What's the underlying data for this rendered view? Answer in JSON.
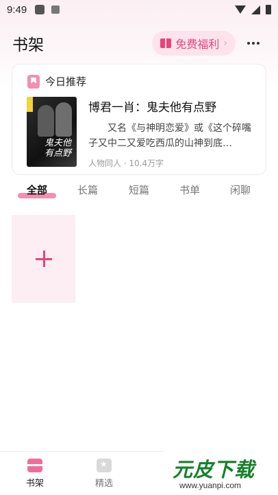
{
  "status_bar": {
    "time": "9:49"
  },
  "header": {
    "title": "书架",
    "welfare_label": "免费福利",
    "welfare_arrow": "›"
  },
  "recommendation": {
    "label": "今日推荐",
    "cover_text": "鬼夫他有点野",
    "book_title": "博君一肖：鬼夫他有点野",
    "description": "又名《与神明恋爱》或《这个碎嘴子又中二又爱吃西瓜的山神到底…",
    "meta": "人物同人 · 10.4万字"
  },
  "tabs": [
    {
      "label": "全部",
      "active": true
    },
    {
      "label": "长篇",
      "active": false
    },
    {
      "label": "短篇",
      "active": false
    },
    {
      "label": "书单",
      "active": false
    },
    {
      "label": "闲聊",
      "active": false
    }
  ],
  "bottom_nav": [
    {
      "label": "书架",
      "icon": "shelf-icon",
      "active": true
    },
    {
      "label": "精选",
      "icon": "featured-icon",
      "active": false
    }
  ],
  "watermark": {
    "logo": "元皮下载",
    "url": "www.yuanpi.com"
  },
  "colors": {
    "accent": "#e8437a",
    "accent_light": "#fde4ec",
    "tab_underline": "#f18fb0"
  }
}
